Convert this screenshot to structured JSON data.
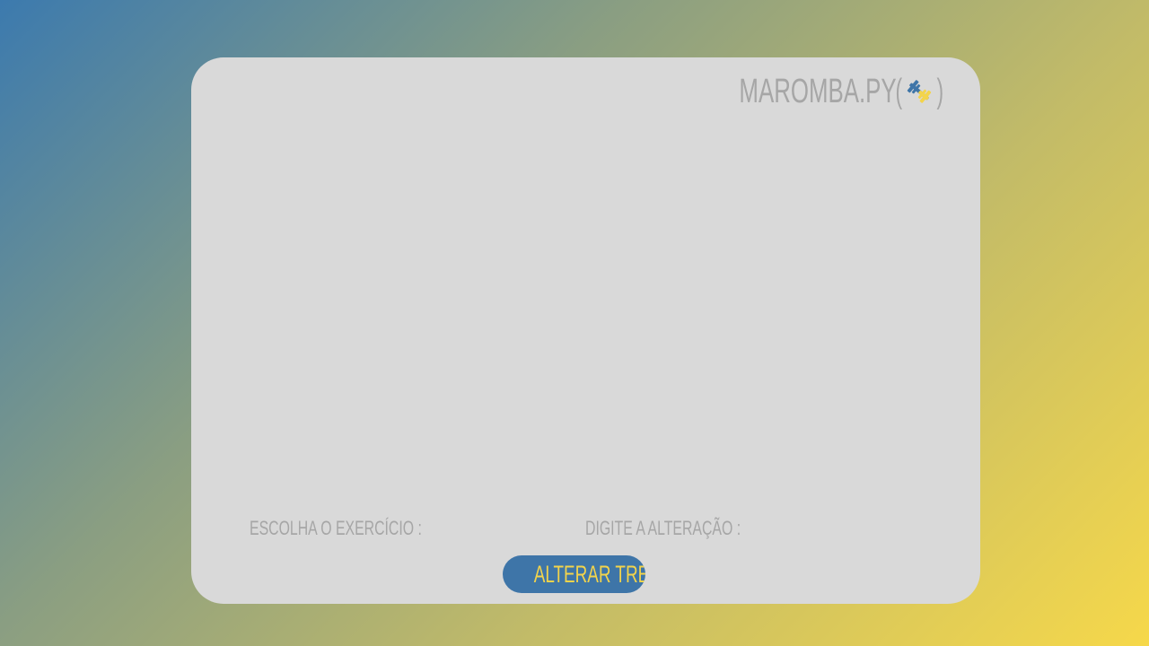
{
  "app": {
    "brand": "MAROMBA.PY",
    "brand_open_paren": "(",
    "brand_close_paren": ")",
    "brand_icon": "dumbbell-icon"
  },
  "form": {
    "exercise_label": "ESCOLHA O EXERCÍCIO :",
    "change_label": "DIGITE A ALTERAÇÃO :",
    "submit_label": "ALTERAR TREINO"
  },
  "colors": {
    "card_bg": "#d9d9d9",
    "text_muted": "#a6a6a6",
    "accent_blue": "#3e75a8",
    "accent_yellow": "#f3d44b"
  }
}
